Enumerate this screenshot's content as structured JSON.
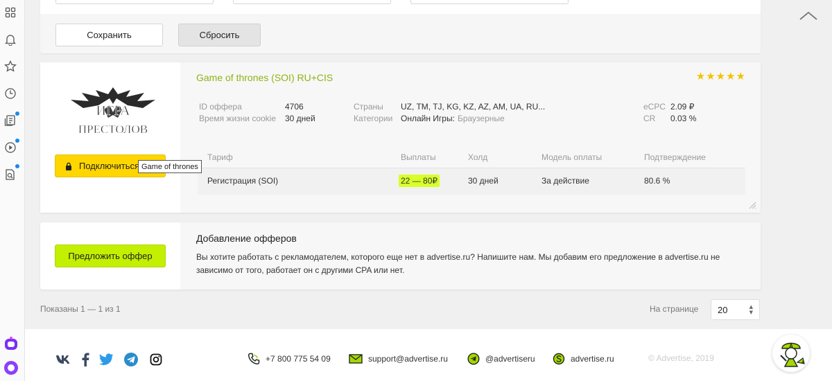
{
  "filters": {
    "save_label": "Сохранить",
    "reset_label": "Сбросить"
  },
  "rail": {
    "icons": [
      "grid-icon",
      "bell-icon",
      "star-icon",
      "clock-icon",
      "news-icon",
      "play-icon",
      "search-doc-icon"
    ]
  },
  "offer": {
    "title": "Game of thrones (SOI) RU+CIS",
    "logo_text_top": "ИГРА",
    "logo_text_bottom": "ПРЕСТОЛОВ",
    "rating": 5,
    "connect_label": "Подключиться",
    "tooltip": "Game of thrones",
    "id_label": "ID оффера",
    "id_value": "4706",
    "cookie_label": "Время жизни cookie",
    "cookie_value": "30 дней",
    "countries_label": "Страны",
    "countries_value": "UZ, TM, TJ, KG, KZ, AZ, AM, UA, RU...",
    "categories_label": "Категории",
    "category_main": "Онлайн Игры:",
    "category_sub": "Браузерные",
    "ecpc_label": "eCPC",
    "ecpc_value": "2.09 ₽",
    "cr_label": "CR",
    "cr_value": "0.03 %",
    "table": {
      "headers": [
        "Тариф",
        "Выплаты",
        "Холд",
        "Модель оплаты",
        "Подтверждение"
      ],
      "row": [
        "Регистрация (SOI)",
        "22 — 80₽",
        "30 дней",
        "За действие",
        "80.6 %"
      ]
    }
  },
  "add_offer": {
    "button_label": "Предложить оффер",
    "title": "Добавление офферов",
    "text": "Вы хотите работать с рекламодателем, которого еще нет в advertise.ru? Напишите нам. Мы добавим его предложение в advertise.ru не зависимо от того, работает он с другими CPA или нет."
  },
  "pagination": {
    "shown": "Показаны 1 — 1 из 1",
    "per_page_label": "На странице",
    "per_page_value": "20"
  },
  "footer": {
    "phone": "+7 800 775 54 09",
    "email": "support@advertise.ru",
    "telegram": "@advertiseru",
    "skype": "advertise.ru",
    "copyright": "© Advertise, 2019",
    "social": [
      "vk-icon",
      "facebook-icon",
      "twitter-icon",
      "telegram-icon",
      "instagram-icon"
    ]
  },
  "colors": {
    "accent_green": "#8cb414",
    "connect_yellow": "#ffd600",
    "propose_lime": "#c3f000",
    "payout_highlight": "#d8ff2a",
    "star": "#f2c200"
  }
}
